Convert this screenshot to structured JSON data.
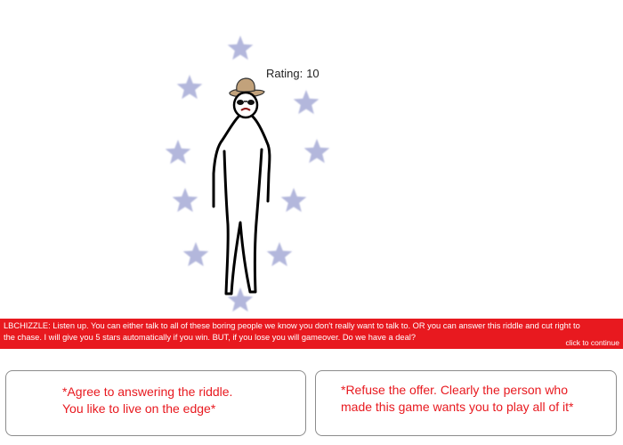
{
  "scene": {
    "rating_label": "Rating:",
    "rating_value": "10",
    "stars_shown": 10,
    "star_color": "#b3b7dc",
    "character": "lbchizzle-stick-figure-with-hat-and-sunglasses"
  },
  "dialog": {
    "speaker": "LBCHIZZLE",
    "text": "LBCHIZZLE: Listen up. You can either talk to all of these boring people we know you don't really want to  talk to. OR you can answer this riddle and cut right to the chase. I will give you 5 stars automatically if you win. BUT, if you lose you will gameover. Do we have a deal?",
    "continue_label": "click to continue",
    "bar_color": "#e8191f"
  },
  "choices": [
    {
      "line1": "*Agree to answering the riddle.",
      "line2": "You like to live on the edge*"
    },
    {
      "line1": "*Refuse the offer. Clearly the person who",
      "line2": "made this game wants you to play all of it*"
    }
  ],
  "choice_text_color": "#e8191f"
}
